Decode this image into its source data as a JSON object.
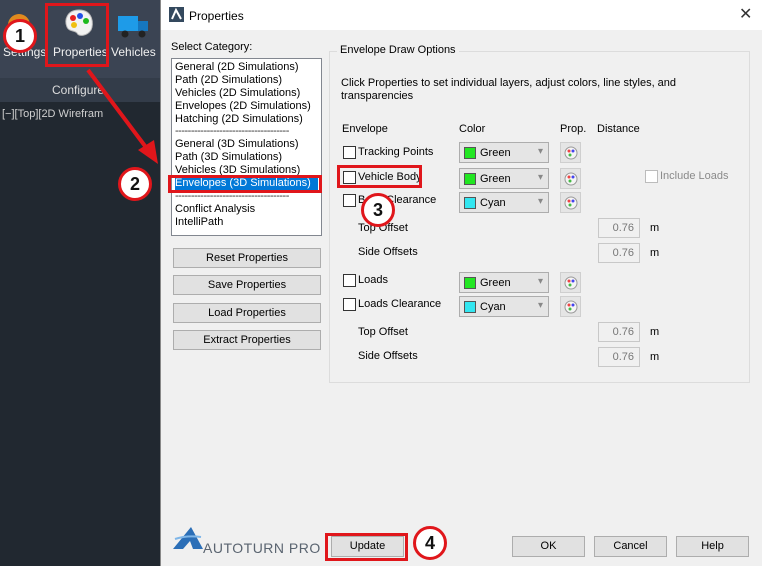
{
  "background_app": {
    "ribbon": {
      "settings_label": "Settings",
      "properties_label": "Properties",
      "vehicles_label": "Vehicles",
      "group_label": "Configure"
    },
    "viewport_label": "[−][Top][2D Wirefram"
  },
  "dialog": {
    "title": "Properties",
    "select_category_label": "Select Category:",
    "categories": [
      "General (2D Simulations)",
      "Path (2D Simulations)",
      "Vehicles (2D Simulations)",
      "Envelopes (2D Simulations)",
      "Hatching (2D Simulations)",
      "------------------------------------",
      "General (3D Simulations)",
      "Path (3D Simulations)",
      "Vehicles (3D Simulations)",
      "Envelopes (3D Simulations)",
      "------------------------------------",
      "Conflict Analysis",
      "IntelliPath"
    ],
    "selected_category": "Envelopes (3D Simulations)",
    "side_buttons": {
      "reset": "Reset Properties",
      "save": "Save Properties",
      "load": "Load Properties",
      "extract": "Extract Properties"
    },
    "group_title": "Envelope Draw Options",
    "description": "Click Properties to set individual layers, adjust colors, line styles, and transparencies",
    "columns": {
      "envelope": "Envelope",
      "color": "Color",
      "prop": "Prop.",
      "distance": "Distance"
    },
    "rows": {
      "tracking_points": {
        "label": "Tracking Points",
        "color": "Green",
        "checked": false
      },
      "vehicle_body": {
        "label": "Vehicle Body",
        "color": "Green",
        "checked": false
      },
      "body_clearance": {
        "label": "Body Clearance",
        "color": "Cyan",
        "checked": false
      },
      "loads": {
        "label": "Loads",
        "color": "Green",
        "checked": false
      },
      "loads_clearance": {
        "label": "Loads Clearance",
        "color": "Cyan",
        "checked": false
      }
    },
    "include_loads_label": "Include Loads",
    "body_top_offset": {
      "label": "Top Offset",
      "value": "0.76",
      "unit": "m"
    },
    "body_side_offsets": {
      "label": "Side Offsets",
      "value": "0.76",
      "unit": "m"
    },
    "loads_top_offset": {
      "label": "Top Offset",
      "value": "0.76",
      "unit": "m"
    },
    "loads_side_offsets": {
      "label": "Side Offsets",
      "value": "0.76",
      "unit": "m"
    },
    "logo_text": "AUTOTURN PRO",
    "buttons": {
      "update": "Update",
      "ok": "OK",
      "cancel": "Cancel",
      "help": "Help"
    }
  },
  "annotations": [
    "1",
    "2",
    "3",
    "4"
  ],
  "colors": {
    "green": "#22e622",
    "cyan": "#33e6f0",
    "annotation_red": "#e0161b",
    "selection_blue": "#0078d7"
  }
}
